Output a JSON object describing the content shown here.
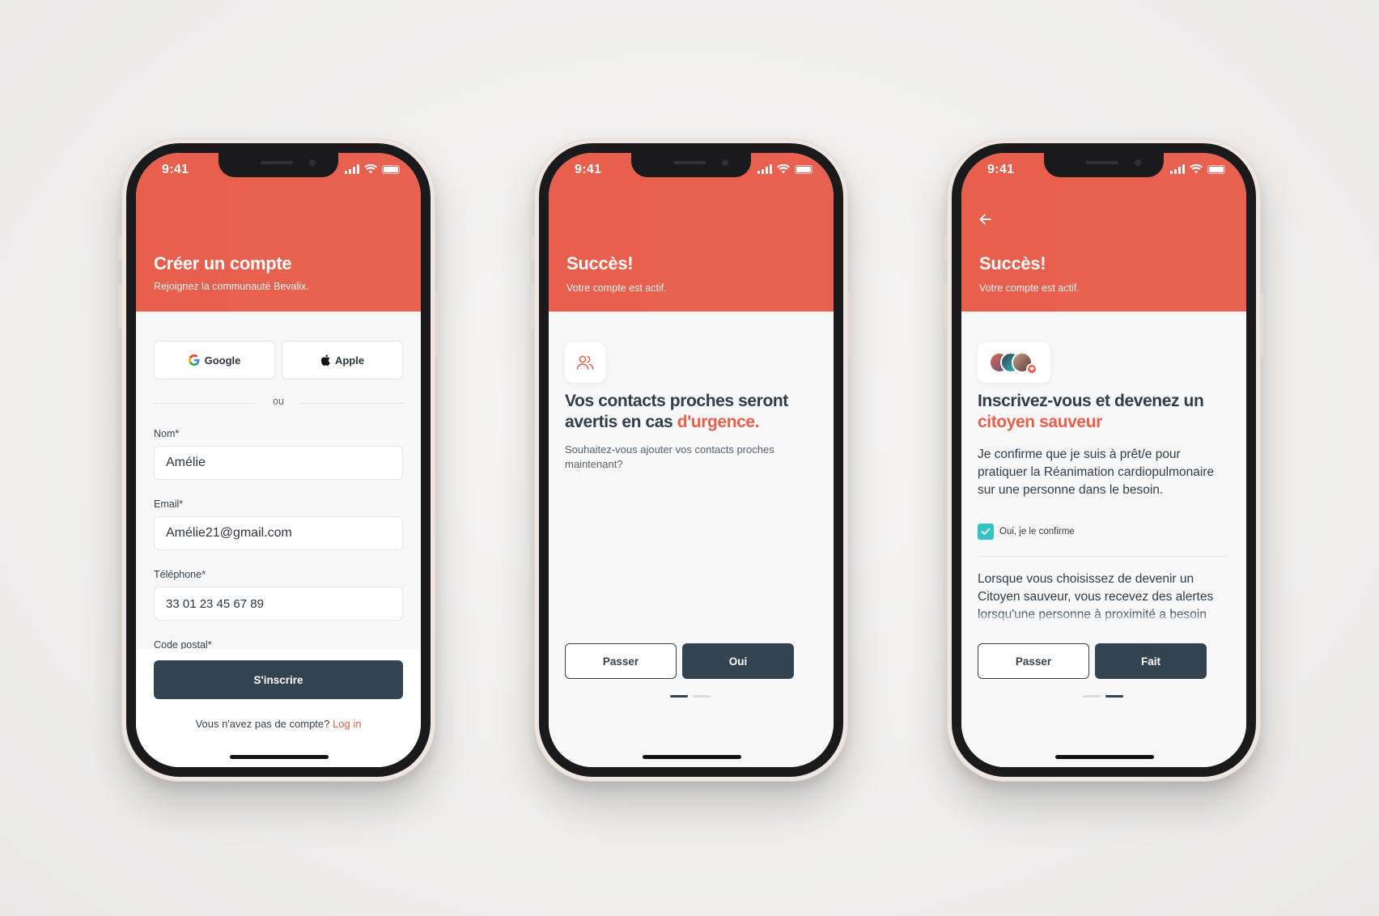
{
  "status_time": "9:41",
  "phone1": {
    "header_title": "Créer un compte",
    "header_subtitle": "Rejoignez la communauté Bevalix.",
    "google_label": "Google",
    "apple_label": "Apple",
    "divider_text": "ou",
    "name_label": "Nom*",
    "name_value": "Amélie",
    "email_label": "Email*",
    "email_value": "Amélie21@gmail.com",
    "phone_label": "Téléphone*",
    "phone_value": "33 01 23 45 67 89",
    "postal_label": "Code postal*",
    "signup_button": "S'inscrire",
    "account_prompt": "Vous n'avez pas de compte?",
    "login_link": "Log in"
  },
  "phone2": {
    "header_title": "Succès!",
    "header_subtitle": "Votre compte est actif.",
    "title_part1": "Vos contacts proches seront avertis en cas ",
    "title_accent": "d'urgence.",
    "body": "Souhaitez-vous ajouter vos contacts proches maintenant?",
    "skip_button": "Passer",
    "yes_button": "Oui"
  },
  "phone3": {
    "header_title": "Succès!",
    "header_subtitle": "Votre compte est actif.",
    "title_part1": "Inscrivez-vous et devenez un ",
    "title_accent": "citoyen sauveur",
    "confirm_text": "Je confirme que je suis à prêt/e pour pratiquer la Réanimation cardiopulmonaire sur une personne dans le besoin.",
    "checkbox_label": "Oui, je le confirme",
    "info_text": "Lorsque vous choisissez de devenir un Citoyen sauveur, vous recevez des alertes lorsqu'une personne à proximité a besoin d'aide.",
    "skip_button": "Passer",
    "done_button": "Fait"
  },
  "colors": {
    "brand": "#e8604c",
    "dark": "#334350",
    "check": "#33c3c6"
  }
}
